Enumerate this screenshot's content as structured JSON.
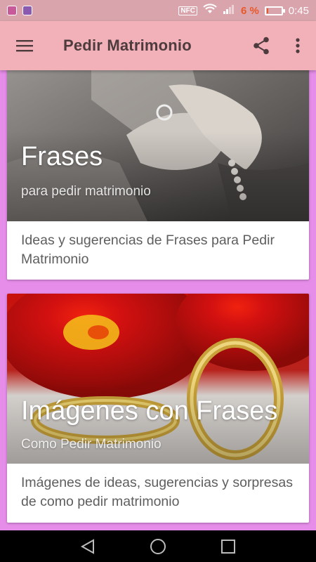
{
  "status_bar": {
    "battery_percent": "6 %",
    "battery_level": 0.06,
    "time": "0:45",
    "nfc_label": "NFC",
    "icons": [
      "app-notification-icon",
      "gallery-notification-icon",
      "nfc-icon",
      "wifi-icon",
      "signal-icon",
      "battery-icon"
    ]
  },
  "app_bar": {
    "title": "Pedir Matrimonio",
    "background": "#f2b1b9",
    "icons": [
      "menu-icon",
      "share-icon",
      "more-vert-icon"
    ]
  },
  "cards": [
    {
      "title": "Frases",
      "subtitle": "para pedir matrimonio",
      "description": "Ideas y sugerencias de Frases para Pedir Matrimonio",
      "image": "hands-ring-photo"
    },
    {
      "title": "Imágenes con Frases",
      "subtitle": "Como Pedir Matrimonio",
      "description": "Imágenes de ideas, sugerencias y sorpresas de como pedir matrimonio",
      "image": "gold-rings-roses-photo"
    }
  ],
  "nav_bar": {
    "icons": [
      "back-icon",
      "home-icon",
      "recents-icon"
    ]
  },
  "colors": {
    "page_background": "#e58de8",
    "status_bar": "#d9a4ac",
    "battery_low": "#e8592a"
  }
}
